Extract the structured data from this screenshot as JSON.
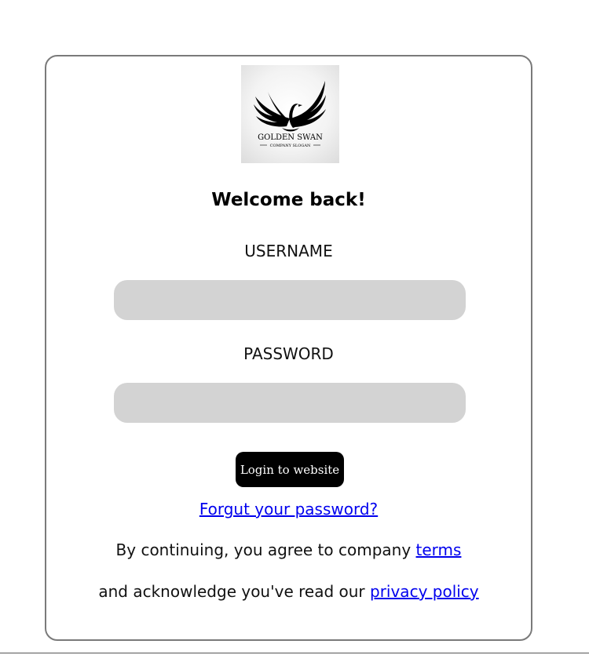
{
  "logo": {
    "brand_name": "GOLDEN SWAN",
    "slogan": "COMPANY SLOGAN",
    "icon": "swan-wings-logo-icon"
  },
  "heading": "Welcome back!",
  "username": {
    "label": "USERNAME",
    "value": "",
    "placeholder": ""
  },
  "password": {
    "label": "PASSWORD",
    "value": "",
    "placeholder": ""
  },
  "login_button": "Login to website",
  "forgot_link": "Forgut your password?",
  "legal": {
    "line1_text": "By continuing, you agree to company ",
    "terms_link": "terms",
    "line2_text": "and acknowledge you've read our ",
    "privacy_link": "privacy policy"
  },
  "colors": {
    "link": "#0000ee",
    "input_bg": "#d3d3d3",
    "button_bg": "#000000",
    "card_border": "#7a7a7a"
  }
}
